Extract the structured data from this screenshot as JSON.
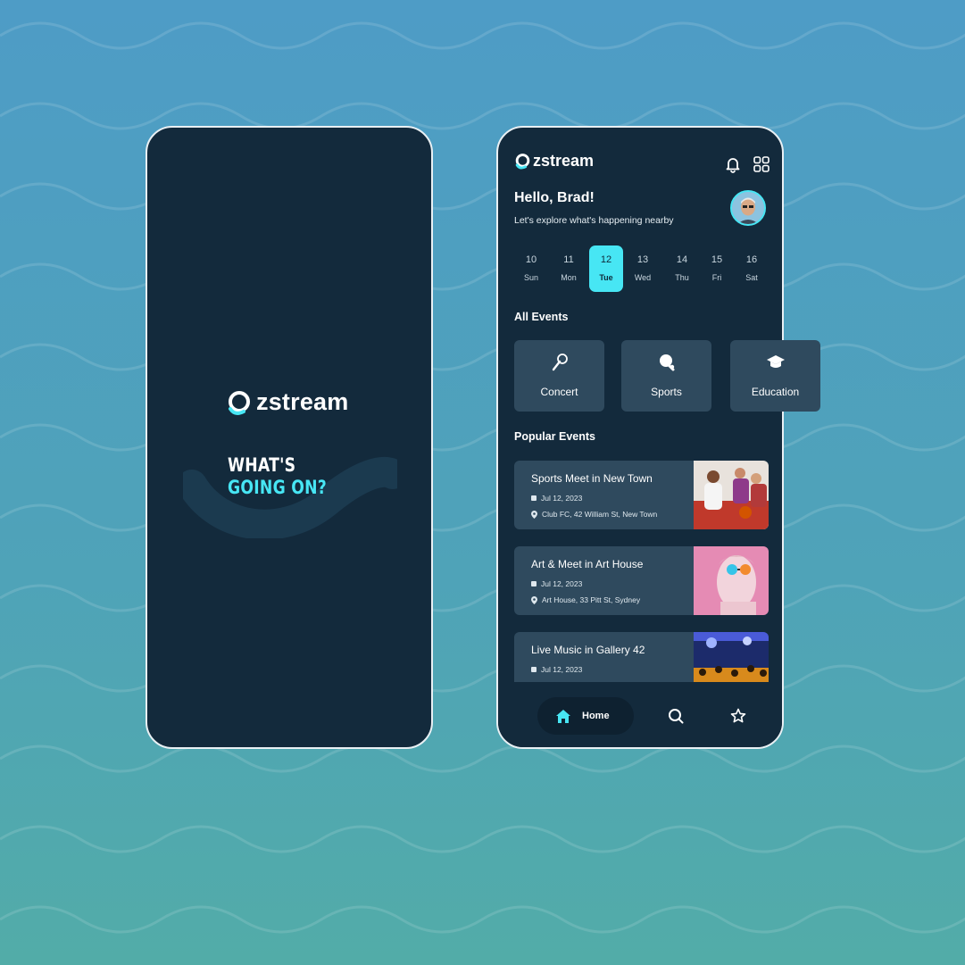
{
  "colors": {
    "accent": "#47e6f4",
    "panel": "#132a3c",
    "card": "#2f4a5e"
  },
  "splash": {
    "logo_text": "zstream",
    "tagline_line1": "WHAT'S",
    "tagline_line2": "GOING ON?"
  },
  "home": {
    "logo_text": "zstream",
    "greeting": "Hello, Brad!",
    "subtitle": "Let's explore what's happening nearby",
    "days": [
      {
        "num": "10",
        "day": "Sun"
      },
      {
        "num": "11",
        "day": "Mon"
      },
      {
        "num": "12",
        "day": "Tue"
      },
      {
        "num": "13",
        "day": "Wed"
      },
      {
        "num": "14",
        "day": "Thu"
      },
      {
        "num": "15",
        "day": "Fri"
      },
      {
        "num": "16",
        "day": "Sat"
      }
    ],
    "selected_day": "12",
    "all_events_title": "All Events",
    "categories": [
      {
        "label": "Concert",
        "icon": "microphone-icon"
      },
      {
        "label": "Sports",
        "icon": "ping-pong-icon"
      },
      {
        "label": "Education",
        "icon": "graduation-cap-icon"
      }
    ],
    "popular_title": "Popular Events",
    "events": [
      {
        "title": "Sports Meet in New Town",
        "date": "Jul 12, 2023",
        "place": "Club FC, 42 William St, New Town"
      },
      {
        "title": "Art & Meet in Art House",
        "date": "Jul 12, 2023",
        "place": "Art House, 33 Pitt St, Sydney"
      },
      {
        "title": "Live Music in Gallery 42",
        "date": "Jul 12, 2023",
        "place": ""
      }
    ],
    "nav": {
      "home_label": "Home",
      "search_icon": "search-icon",
      "star_icon": "star-icon"
    }
  }
}
